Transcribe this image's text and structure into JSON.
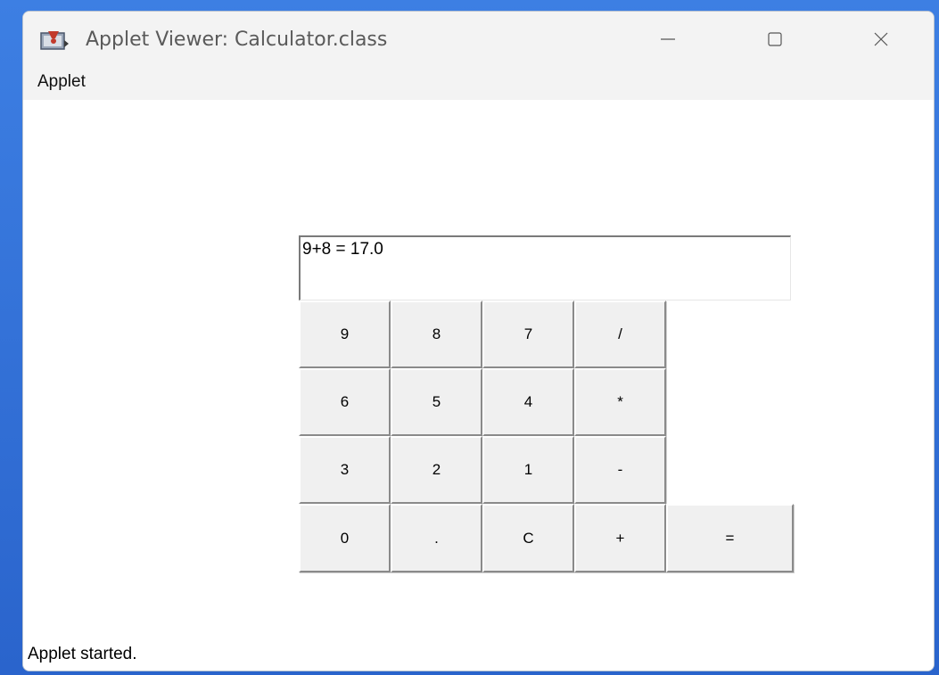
{
  "window": {
    "title": "Applet Viewer: Calculator.class"
  },
  "menubar": {
    "items": [
      {
        "label": "Applet"
      }
    ]
  },
  "calculator": {
    "display_text": "9+8 = 17.0",
    "keys": [
      {
        "label": "9"
      },
      {
        "label": "8"
      },
      {
        "label": "7"
      },
      {
        "label": "/"
      },
      {
        "label": "6"
      },
      {
        "label": "5"
      },
      {
        "label": "4"
      },
      {
        "label": "*"
      },
      {
        "label": "3"
      },
      {
        "label": "2"
      },
      {
        "label": "1"
      },
      {
        "label": "-"
      },
      {
        "label": "0"
      },
      {
        "label": "."
      },
      {
        "label": "C"
      },
      {
        "label": "+"
      },
      {
        "label": "="
      }
    ]
  },
  "status": {
    "text": "Applet started."
  },
  "icons": {
    "app": "java-applet-icon",
    "minimize": "minimize-icon",
    "maximize": "maximize-icon",
    "close": "close-icon"
  },
  "colors": {
    "desktop": "#2f6fd6",
    "titlebar": "#f3f3f3",
    "button_face": "#f0f0f0"
  }
}
